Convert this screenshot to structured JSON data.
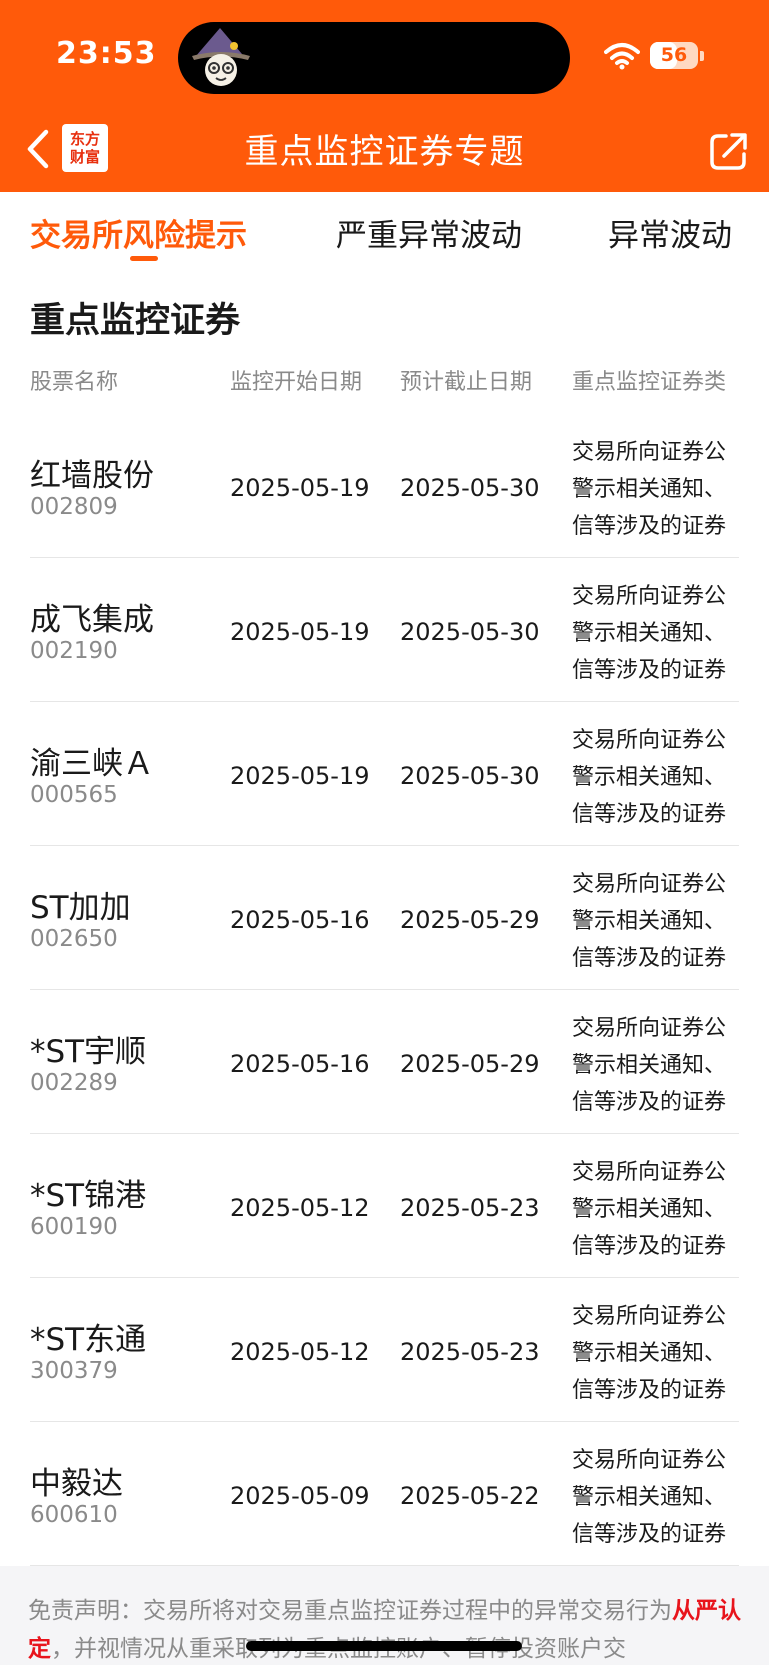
{
  "status_bar": {
    "time": "23:53",
    "battery_level": "56",
    "battery_fraction": 0.56,
    "wifi_icon": "wifi-icon"
  },
  "nav": {
    "title": "重点监控证券专题",
    "logo_line1": "东方",
    "logo_line2": "财富",
    "back_icon": "chevron-left-icon",
    "share_icon": "share-icon"
  },
  "tabs": [
    {
      "label": "交易所风险提示",
      "active": true
    },
    {
      "label": "严重异常波动",
      "active": false
    },
    {
      "label": "异常波动",
      "active": false
    }
  ],
  "section_title": "重点监控证券",
  "table": {
    "headers": [
      "股票名称",
      "监控开始日期",
      "预计截止日期",
      "重点监控证券类"
    ],
    "rows": [
      {
        "name": "红墙股份",
        "code": "002809",
        "start": "2025-05-19",
        "end": "2025-05-30",
        "type_lines": [
          "交易所向证券公",
          "警示相关通知、",
          "信等涉及的证券"
        ]
      },
      {
        "name": "成飞集成",
        "code": "002190",
        "start": "2025-05-19",
        "end": "2025-05-30",
        "type_lines": [
          "交易所向证券公",
          "警示相关通知、",
          "信等涉及的证券"
        ]
      },
      {
        "name": "渝三峡Ａ",
        "code": "000565",
        "start": "2025-05-19",
        "end": "2025-05-30",
        "type_lines": [
          "交易所向证券公",
          "警示相关通知、",
          "信等涉及的证券"
        ]
      },
      {
        "name": "ST加加",
        "code": "002650",
        "start": "2025-05-16",
        "end": "2025-05-29",
        "type_lines": [
          "交易所向证券公",
          "警示相关通知、",
          "信等涉及的证券"
        ]
      },
      {
        "name": "*ST宇顺",
        "code": "002289",
        "start": "2025-05-16",
        "end": "2025-05-29",
        "type_lines": [
          "交易所向证券公",
          "警示相关通知、",
          "信等涉及的证券"
        ]
      },
      {
        "name": "*ST锦港",
        "code": "600190",
        "start": "2025-05-12",
        "end": "2025-05-23",
        "type_lines": [
          "交易所向证券公",
          "警示相关通知、",
          "信等涉及的证券"
        ]
      },
      {
        "name": "*ST东通",
        "code": "300379",
        "start": "2025-05-12",
        "end": "2025-05-23",
        "type_lines": [
          "交易所向证券公",
          "警示相关通知、",
          "信等涉及的证券"
        ]
      },
      {
        "name": "中毅达",
        "code": "600610",
        "start": "2025-05-09",
        "end": "2025-05-22",
        "type_lines": [
          "交易所向证券公",
          "警示相关通知、",
          "信等涉及的证券"
        ]
      }
    ]
  },
  "disclaimer": {
    "prefix": "免责声明：交易所将对交易重点监控证券过程中的异常交易行为",
    "highlight": "从严认定",
    "suffix": "，并视情况从重采取列为重点监控账户、暂停投资账户交"
  },
  "colors": {
    "brand": "#ff5a0a",
    "highlight": "#e8141c"
  }
}
